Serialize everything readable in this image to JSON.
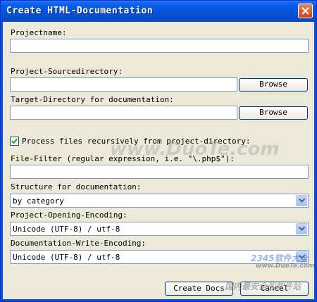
{
  "window": {
    "title": "Create HTML-Documentation"
  },
  "form": {
    "projectname_label": "Projectname:",
    "projectname_value": "",
    "source_label": "Project-Sourcedirectory:",
    "source_value": "",
    "source_browse": "Browse",
    "target_label": "Target-Directory for documentation:",
    "target_value": "",
    "target_browse": "Browse",
    "recursive_label": "Process files recursively from project-directory:",
    "recursive_checked": true,
    "filter_label": "File-Filter (regular expression, i.e. \"\\.php$\"):",
    "filter_value": "",
    "structure_label": "Structure for documentation:",
    "structure_value": "by category",
    "opening_label": "Project-Opening-Encoding:",
    "opening_value": "Unicode (UTF-8) / utf-8",
    "write_label": "Documentation-Write-Encoding:",
    "write_value": "Unicode (UTF-8) / utf-8"
  },
  "buttons": {
    "create": "Create Docs",
    "cancel": "Cancel"
  },
  "watermarks": {
    "main": "www.DuoTe.com",
    "brand": "2345软件大全",
    "url": "www.DuoTe.com",
    "footer": "国内最安全的软件站"
  }
}
